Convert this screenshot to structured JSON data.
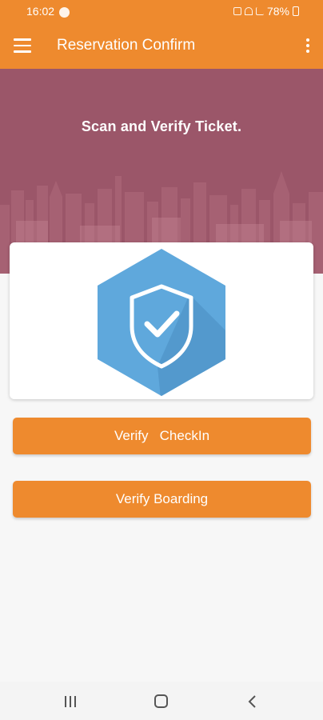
{
  "status_bar": {
    "time": "16:02",
    "battery": "78%",
    "icons": [
      "data-saver-icon",
      "alarm-icon",
      "wifi-icon",
      "signal-icon",
      "signal-icon",
      "battery-icon"
    ]
  },
  "app_bar": {
    "title": "Reservation Confirm",
    "menu_icon": "hamburger-menu-icon",
    "overflow_icon": "more-vertical-icon"
  },
  "hero": {
    "heading": "Scan and Verify Ticket."
  },
  "verify_card": {
    "icon": "shield-check-icon"
  },
  "buttons": {
    "verify_checkin": "Verify   CheckIn",
    "verify_boarding": "Verify Boarding"
  },
  "nav_bar": {
    "icons": [
      "recent-apps-icon",
      "home-icon",
      "back-icon"
    ]
  },
  "colors": {
    "primary_orange": "#ee8a2e",
    "hero_maroon": "#9b5669",
    "shield_blue": "#5fa8dc",
    "background": "#f7f7f7"
  }
}
